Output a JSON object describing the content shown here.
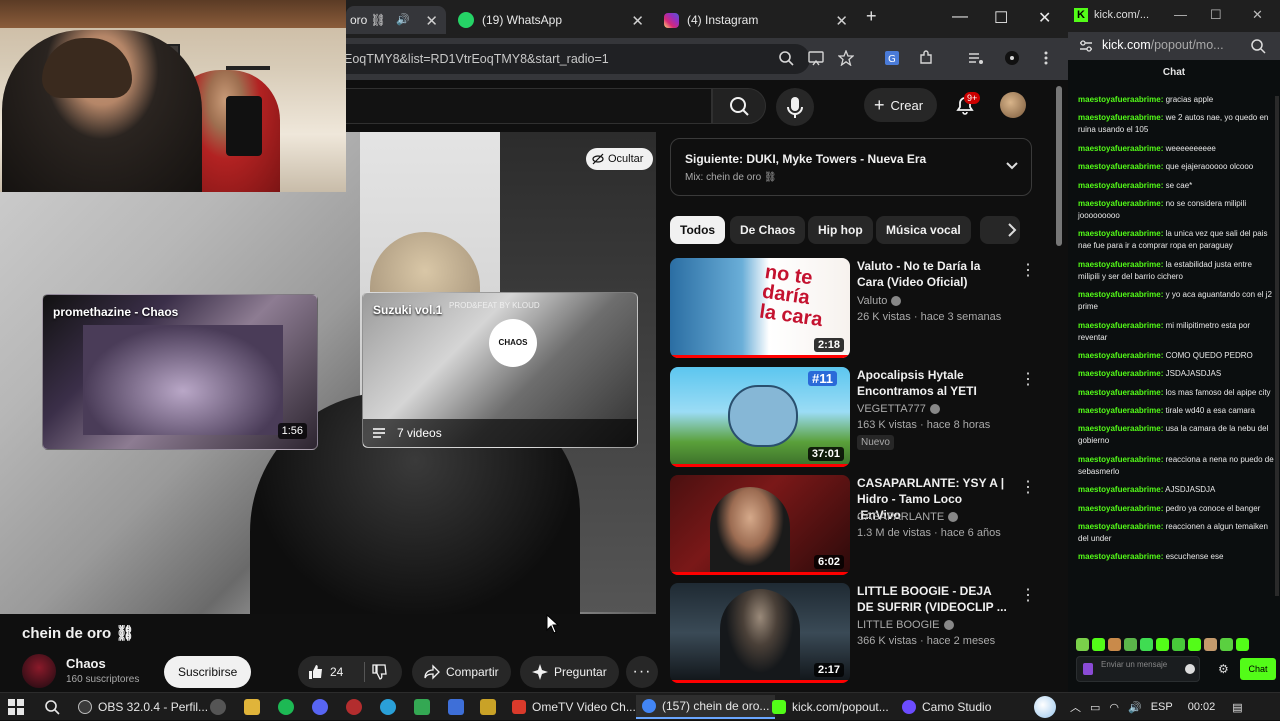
{
  "browser": {
    "tabs": [
      {
        "label": "oro ⛓",
        "active": true
      },
      {
        "label": "(19) WhatsApp",
        "active": false
      },
      {
        "label": "(4) Instagram",
        "active": false
      }
    ],
    "new_tab": "+",
    "url": "EoqTMY8&list=RD1VtrEoqTMY8&start_radio=1"
  },
  "youtube": {
    "create_label": "Crear",
    "notif_count": "9+",
    "end_cards": [
      {
        "title": "promethazine - Chaos",
        "duration": "1:56"
      },
      {
        "title": "Suzuki vol.1",
        "playlist_count": "7 videos",
        "thumb_caption": "PROD&FEAT BY KLOUD"
      }
    ],
    "hide_button": "Ocultar",
    "video_title": "chein de oro ⛓",
    "channel": {
      "name": "Chaos",
      "subscribers": "160 suscriptores"
    },
    "subscribe_label": "Suscribirse",
    "likes": "24",
    "share_label": "Compartir",
    "ask_label": "Preguntar",
    "up_next": {
      "title": "Siguiente: DUKI, Myke Towers - Nueva Era",
      "subtitle": "Mix: chein de oro ⛓"
    },
    "chips": [
      "Todos",
      "De Chaos",
      "Hip hop",
      "Música vocal"
    ],
    "recommendations": [
      {
        "title": "Valuto - No te Daría la Cara (Video Oficial)",
        "channel": "Valuto",
        "meta": "26 K vistas · hace 3 semanas",
        "duration": "2:18",
        "badge": "",
        "watched": 1.0
      },
      {
        "title": "Apocalipsis Hytale Encontramos al YETI",
        "channel": "VEGETTA777",
        "meta": "163 K vistas · hace 8 horas",
        "duration": "37:01",
        "badge": "Nuevo",
        "watched": 1.0
      },
      {
        "title": "CASAPARLANTE: YSY A | Hidro - Tamo Loco .EnVivo",
        "channel": "CASAPARLANTE",
        "meta": "1.3 M de vistas · hace 6 años",
        "duration": "6:02",
        "badge": "",
        "watched": 1.0
      },
      {
        "title": "LITTLE BOOGIE - DEJA DE SUFRIR (VIDEOCLIP ...",
        "channel": "LITTLE BOOGIE",
        "meta": "366 K vistas · hace 2 meses",
        "duration": "2:17",
        "badge": "",
        "watched": 1.0
      }
    ]
  },
  "kick": {
    "tab_title": "kick.com/...",
    "url_host": "kick.com",
    "url_path": "/popout/mo...",
    "chat_header": "Chat",
    "messages": [
      {
        "user": "maestoyafueraabrime:",
        "text": "gracias apple"
      },
      {
        "user": "maestoyafueraabrime:",
        "text": "we 2 autos nae, yo quedo en ruina usando el 105"
      },
      {
        "user": "maestoyafueraabrime:",
        "text": "weeeeeeeeee"
      },
      {
        "user": "maestoyafueraabrime:",
        "text": "que ejajeraooooo olcooo"
      },
      {
        "user": "maestoyafueraabrime:",
        "text": "se cae*"
      },
      {
        "user": "maestoyafueraabrime:",
        "text": "no se considera milipili jooooooooo"
      },
      {
        "user": "maestoyafueraabrime:",
        "text": "la unica vez que sali del pais nae fue para ir a comprar ropa en paraguay"
      },
      {
        "user": "maestoyafueraabrime:",
        "text": "la estabilidad justa entre milipili y ser del barrio cichero"
      },
      {
        "user": "maestoyafueraabrime:",
        "text": "y yo aca aguantando con el j2 prime"
      },
      {
        "user": "maestoyafueraabrime:",
        "text": "mi milipitimetro esta por reventar"
      },
      {
        "user": "maestoyafueraabrime:",
        "text": "COMO QUEDO PEDRO"
      },
      {
        "user": "maestoyafueraabrime:",
        "text": "JSDAJASDJAS"
      },
      {
        "user": "maestoyafueraabrime:",
        "text": "los mas famoso del apipe city"
      },
      {
        "user": "maestoyafueraabrime:",
        "text": "tirale wd40 a esa camara"
      },
      {
        "user": "maestoyafueraabrime:",
        "text": "usa la camara de la nebu del gobierno"
      },
      {
        "user": "maestoyafueraabrime:",
        "text": "reacciona a nena no puedo de sebasmerlo"
      },
      {
        "user": "maestoyafueraabrime:",
        "text": "AJSDJASDJA"
      },
      {
        "user": "maestoyafueraabrime:",
        "text": "pedro ya conoce el banger"
      },
      {
        "user": "maestoyafueraabrime:",
        "text": "reaccionen a algun temaiken del under"
      },
      {
        "user": "maestoyafueraabrime:",
        "text": "escuchense ese"
      }
    ],
    "input_placeholder": "Enviar un mensaje",
    "send_label": "Chat"
  },
  "taskbar": {
    "items": [
      {
        "label": "OBS 32.0.4 - Perfil...",
        "color": "#3a3a3a"
      },
      {
        "label": "OmeTV Video Ch...",
        "color": "#d93a2b"
      },
      {
        "label": "(157) chein de oro...",
        "color": "#4285f4"
      },
      {
        "label": "kick.com/popout...",
        "color": "#53fc18"
      },
      {
        "label": "Camo Studio",
        "color": "#6c4cff"
      }
    ],
    "language": "ESP",
    "time": "00:02"
  }
}
